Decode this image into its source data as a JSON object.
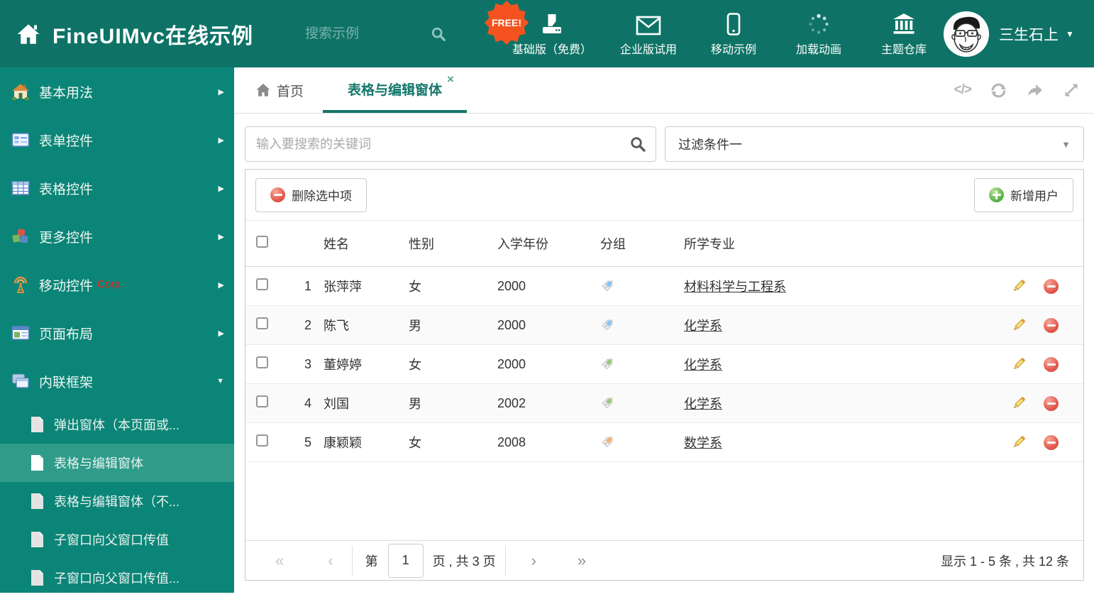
{
  "ui": {
    "caret_down": "▼",
    "arrow_right": "▶",
    "close": "×",
    "code_icon_glyph": "</>"
  },
  "colors": {
    "header_bg": "#0e7366",
    "sidebar_bg": "#0b8577",
    "sidebar_selected_bg": "#2f9c8a",
    "accent_teal": "#14776b",
    "badge_orange": "#f4531f",
    "corp_red": "#ff1a1a",
    "tag_blue": "#85c4f0",
    "tag_green": "#9cc87e",
    "tag_orange": "#f5b26e",
    "delete_red": "#e2594d",
    "add_green": "#62b44e"
  },
  "header": {
    "title": "FineUIMvc在线示例",
    "search_placeholder": "搜索示例",
    "free_badge": "FREE!",
    "nav_items": [
      {
        "label": "基础版（免费）",
        "icon": "download-icon"
      },
      {
        "label": "企业版试用",
        "icon": "envelope-icon"
      },
      {
        "label": "移动示例",
        "icon": "mobile-icon"
      },
      {
        "label": "加载动画",
        "icon": "spinner-icon"
      },
      {
        "label": "主题仓库",
        "icon": "bank-icon"
      }
    ],
    "user_name": "三生石上"
  },
  "sidebar": {
    "items": [
      {
        "label": "基本用法",
        "icon": "home-icon"
      },
      {
        "label": "表单控件",
        "icon": "form-icon"
      },
      {
        "label": "表格控件",
        "icon": "table-icon"
      },
      {
        "label": "更多控件",
        "icon": "cubes-icon"
      },
      {
        "label": "移动控件",
        "badge": "Corp.",
        "icon": "antenna-icon"
      },
      {
        "label": "页面布局",
        "icon": "layout-icon"
      },
      {
        "label": "内联框架",
        "icon": "frames-icon",
        "expanded": true
      }
    ],
    "subitems": [
      {
        "label": "弹出窗体（本页面或..."
      },
      {
        "label": "表格与编辑窗体",
        "selected": true
      },
      {
        "label": "表格与编辑窗体（不..."
      },
      {
        "label": "子窗口向父窗口传值"
      },
      {
        "label": "子窗口向父窗口传值..."
      }
    ]
  },
  "tabs": {
    "home_label": "首页",
    "active_label": "表格与编辑窗体"
  },
  "filters": {
    "search_placeholder": "输入要搜索的关键词",
    "filter_value": "过滤条件一"
  },
  "toolbar": {
    "delete_label": "删除选中项",
    "add_label": "新增用户"
  },
  "table": {
    "headers": [
      "姓名",
      "性别",
      "入学年份",
      "分组",
      "所学专业"
    ],
    "rows": [
      {
        "num": "1",
        "name": "张萍萍",
        "gender": "女",
        "year": "2000",
        "tag": "blue",
        "major": "材料科学与工程系"
      },
      {
        "num": "2",
        "name": "陈飞",
        "gender": "男",
        "year": "2000",
        "tag": "blue",
        "major": "化学系"
      },
      {
        "num": "3",
        "name": "董婷婷",
        "gender": "女",
        "year": "2000",
        "tag": "green",
        "major": "化学系"
      },
      {
        "num": "4",
        "name": "刘国",
        "gender": "男",
        "year": "2002",
        "tag": "green",
        "major": "化学系"
      },
      {
        "num": "5",
        "name": "康颖颖",
        "gender": "女",
        "year": "2008",
        "tag": "orange",
        "major": "数学系"
      }
    ]
  },
  "pagination": {
    "first_icon": "«",
    "prev_icon": "‹",
    "next_icon": "›",
    "last_icon": "»",
    "prefix": "第",
    "page_value": "1",
    "suffix": "页 , 共 3 页",
    "summary": "显示 1 - 5 条 , 共 12 条"
  }
}
